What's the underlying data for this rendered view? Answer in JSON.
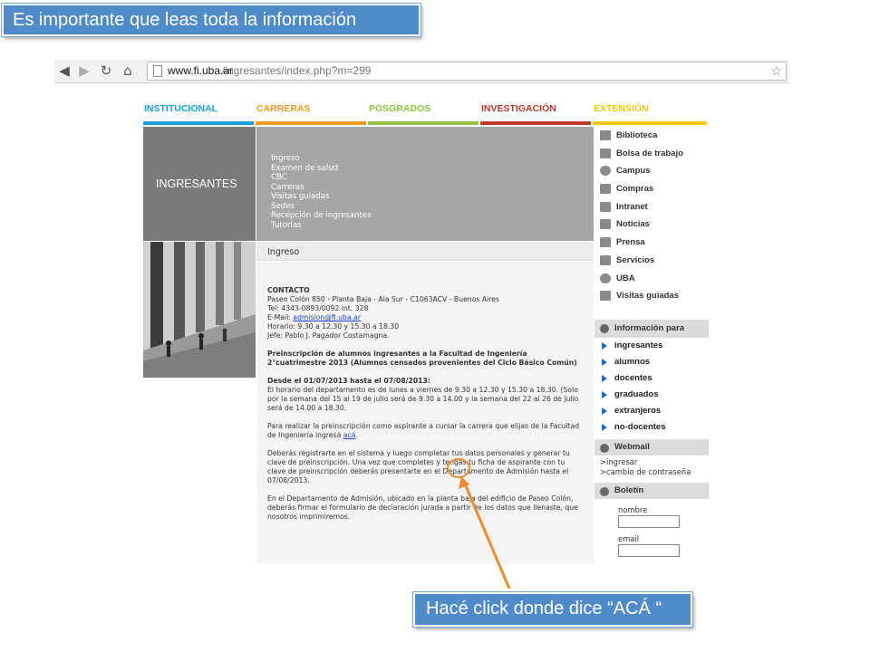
{
  "callouts": {
    "top": "Es importante que leas toda la información",
    "bottom": "Hacé click  donde dice “ACÁ “"
  },
  "browser": {
    "url_host": "www.fi.uba.ar",
    "url_path": "/ingresantes/index.php?m=299",
    "icons": [
      "back-icon",
      "forward-icon",
      "reload-icon",
      "home-icon",
      "star-icon"
    ]
  },
  "nav": [
    {
      "label": "INSTITUCIONAL",
      "color": "#1aa0dc"
    },
    {
      "label": "CARRERAS",
      "color": "#f29a1d"
    },
    {
      "label": "POSGRADOS",
      "color": "#8dc63f"
    },
    {
      "label": "INVESTIGACIÓN",
      "color": "#c0392b"
    },
    {
      "label": "EXTENSIÓN",
      "color": "#f2c811"
    }
  ],
  "banner": {
    "title": "INGRESANTES",
    "submenu": [
      "Ingreso",
      "Examen de salud",
      "CBC",
      "Carreras",
      "Visitas guiadas",
      "Sedes",
      "Recepción de ingresantes",
      "Tutorías"
    ]
  },
  "section_title": "Ingreso",
  "content": {
    "contacto_title": "CONTACTO",
    "contacto_lines": [
      "Paseo Colón 850 - Planta Baja - Ala Sur - C1063ACV - Buenos Aires",
      "Tel: 4343-0893/0092  int. 328"
    ],
    "email_label": "E-Mail: ",
    "email": "admision@fi.uba.ar",
    "horario": "Horario: 9.30 a 12.30 y 15.30 a 18.30",
    "jefe": "Jefe: Pablo J. Pagador Costamagna.",
    "preinscripcion_title": "Preinscripción de alumnos ingresantes a la Facultad de Ingeniería 2°cuatrimestre 2013 (Alumnos censados provenientes del Ciclo Básico Común)",
    "desde_title": "Desde el 01/07/2013 hasta el 07/08/2013:",
    "desde_text": "El horario del departamento es de lunes a viernes de 9.30 a 12.30 y 15.30 a 18.30. (Solo por la semana del 15 al 19 de julio será de 9.30 a 14.00 y la semana del 22 al 26 de julio será de 14.00 a 18.30.",
    "para_text": "Para realizar la preinscripción como aspirante a cursar la carrera que elijas de la Facultad de Ingeniería  ingresá ",
    "aca_link": "acá",
    "deberas_text": "Deberás registrarte en el sistema y luego completar tus datos personales y generar tu clave de preinscripción. Una vez que completes y tengas tu ficha de aspirante con tu clave de preinscripción deberás presentarte en el Departamento de Admisión hasta el 07/08/2013.",
    "en_el_text": "En el Departamento de Admisión, ubicado en la planta baja del edificio de Paseo Colón, deberás firmar el formulario de declaración jurada a partir de los datos que llenaste, que nosotros imprimiremos."
  },
  "sidebar": {
    "links": [
      {
        "label": "Biblioteca",
        "icon": "books-icon"
      },
      {
        "label": "Bolsa de trabajo",
        "icon": "folder-icon"
      },
      {
        "label": "Campus",
        "icon": "refresh-icon"
      },
      {
        "label": "Compras",
        "icon": "bag-icon"
      },
      {
        "label": "Intranet",
        "icon": "lock-icon"
      },
      {
        "label": "Noticias",
        "icon": "news-icon"
      },
      {
        "label": "Prensa",
        "icon": "rss-icon"
      },
      {
        "label": "Servicios",
        "icon": "wrench-icon"
      },
      {
        "label": "UBA",
        "icon": "globe-icon"
      },
      {
        "label": "Visitas guiadas",
        "icon": "people-icon"
      }
    ],
    "info_title": "Información para",
    "info_items": [
      "ingresantes",
      "alumnos",
      "docentes",
      "graduados",
      "extranjeros",
      "no-docentes"
    ],
    "webmail_title": "Webmail",
    "webmail_links": [
      ">ingresar",
      ">cambio de contraseña"
    ],
    "boletin_title": "Boletín",
    "boletin_fields": [
      "nombre",
      "email"
    ]
  },
  "colors": {
    "callout": "#4f8ac9",
    "highlight": "#f08c2c",
    "link": "#1a3fd0",
    "info_arrow": "#1e67c9"
  }
}
